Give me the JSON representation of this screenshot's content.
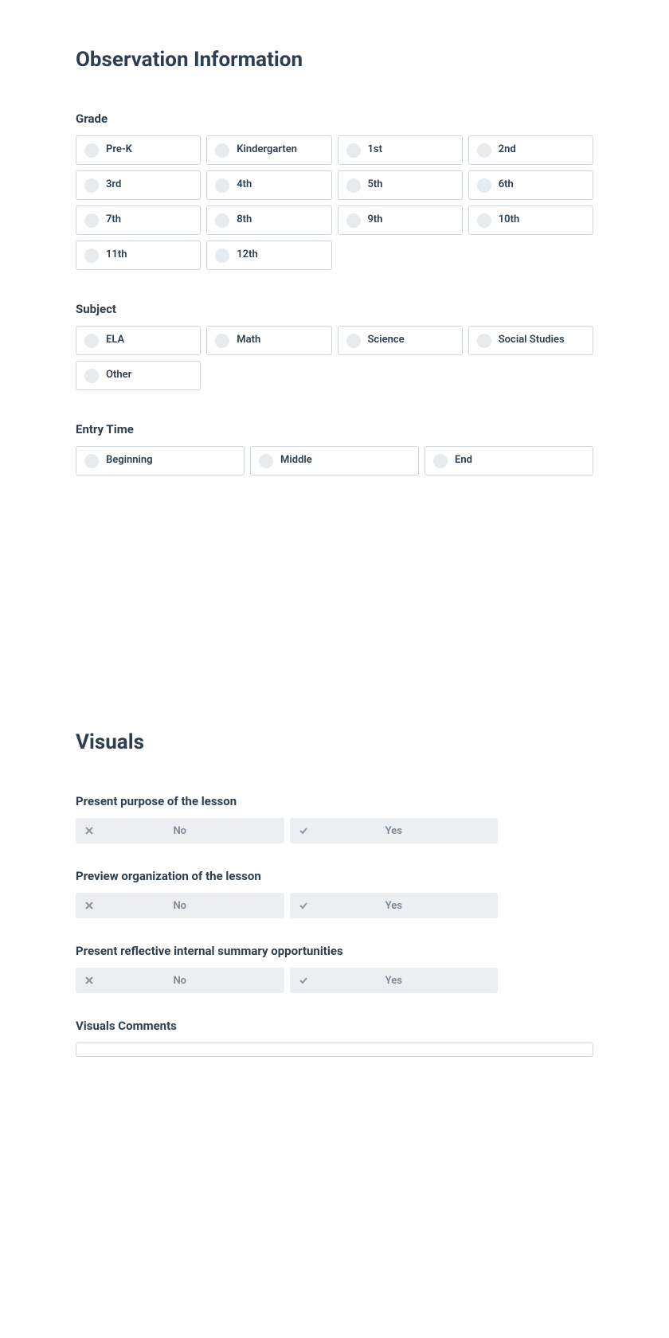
{
  "section1": {
    "title": "Observation Information",
    "grade": {
      "label": "Grade",
      "options": [
        "Pre-K",
        "Kindergarten",
        "1st",
        "2nd",
        "3rd",
        "4th",
        "5th",
        "6th",
        "7th",
        "8th",
        "9th",
        "10th",
        "11th",
        "12th"
      ]
    },
    "subject": {
      "label": "Subject",
      "options": [
        "ELA",
        "Math",
        "Science",
        "Social Studies",
        "Other"
      ]
    },
    "entry_time": {
      "label": "Entry Time",
      "options": [
        "Beginning",
        "Middle",
        "End"
      ]
    }
  },
  "section2": {
    "title": "Visuals",
    "q1": {
      "label": "Present purpose of the lesson",
      "no": "No",
      "yes": "Yes"
    },
    "q2": {
      "label": "Preview organization of the lesson",
      "no": "No",
      "yes": "Yes"
    },
    "q3": {
      "label": "Present reflective internal summary opportunities",
      "no": "No",
      "yes": "Yes"
    },
    "comments_label": "Visuals Comments"
  }
}
